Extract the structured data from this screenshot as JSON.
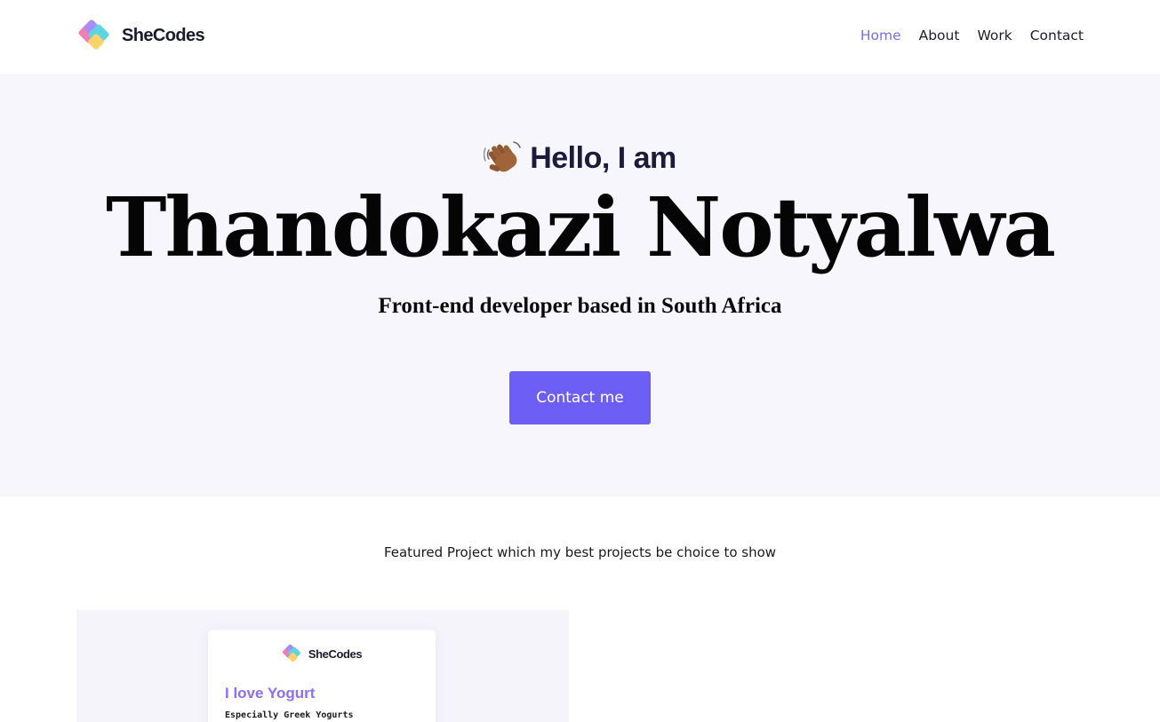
{
  "navbar": {
    "brand": "SheCodes",
    "links": [
      {
        "label": "Home",
        "active": true
      },
      {
        "label": "About",
        "active": false
      },
      {
        "label": "Work",
        "active": false
      },
      {
        "label": "Contact",
        "active": false
      }
    ]
  },
  "hero": {
    "greeting_icon": "waving-hand-icon",
    "greeting": "Hello, I am",
    "name": "Thandokazi Notyalwa",
    "subtitle": "Front-end developer based in South Africa",
    "cta_label": "Contact me"
  },
  "featured": {
    "caption": "Featured Project which my best projects be choice to show",
    "project": {
      "brand": "SheCodes",
      "title": "I love Yogurt",
      "subtitle": "Especially Greek Yogurts"
    }
  },
  "colors": {
    "accent": "#6d5ff5",
    "active_link": "#7a6cf0",
    "hero_background": "#f7f6fc",
    "card_title": "#8b6ff0"
  }
}
